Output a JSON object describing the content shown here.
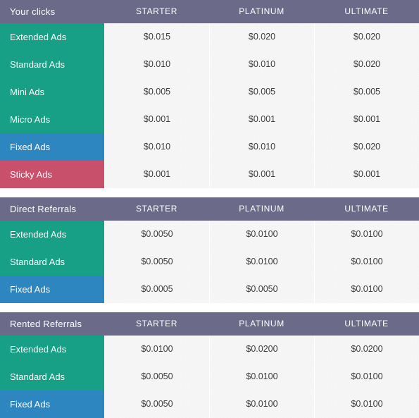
{
  "theme": {
    "header_bg": "#6b6a88",
    "header_text": "#ffffff",
    "green": "#17a085",
    "blue": "#2e86c1",
    "pink": "#c9506b",
    "cell_bg": "#ececec",
    "cell_text": "#3b3b3b",
    "page_bg": "#ffffff"
  },
  "tables": [
    {
      "title": "Your clicks",
      "columns": [
        "STARTER",
        "PLATINUM",
        "ULTIMATE"
      ],
      "rows": [
        {
          "label": "Extended Ads",
          "color": "green",
          "values": [
            "$0.015",
            "$0.020",
            "$0.020"
          ]
        },
        {
          "label": "Standard Ads",
          "color": "green",
          "values": [
            "$0.010",
            "$0.010",
            "$0.020"
          ]
        },
        {
          "label": "Mini Ads",
          "color": "green",
          "values": [
            "$0.005",
            "$0.005",
            "$0.005"
          ]
        },
        {
          "label": "Micro Ads",
          "color": "green",
          "values": [
            "$0.001",
            "$0.001",
            "$0.001"
          ]
        },
        {
          "label": "Fixed Ads",
          "color": "blue",
          "values": [
            "$0.010",
            "$0.010",
            "$0.020"
          ]
        },
        {
          "label": "Sticky Ads",
          "color": "pink",
          "values": [
            "$0.001",
            "$0.001",
            "$0.001"
          ]
        }
      ]
    },
    {
      "title": "Direct Referrals",
      "columns": [
        "STARTER",
        "PLATINUM",
        "ULTIMATE"
      ],
      "rows": [
        {
          "label": "Extended Ads",
          "color": "green",
          "values": [
            "$0.0050",
            "$0.0100",
            "$0.0100"
          ]
        },
        {
          "label": "Standard Ads",
          "color": "green",
          "values": [
            "$0.0050",
            "$0.0100",
            "$0.0100"
          ]
        },
        {
          "label": "Fixed Ads",
          "color": "blue",
          "values": [
            "$0.0005",
            "$0.0050",
            "$0.0100"
          ]
        }
      ]
    },
    {
      "title": "Rented Referrals",
      "columns": [
        "STARTER",
        "PLATINUM",
        "ULTIMATE"
      ],
      "rows": [
        {
          "label": "Extended Ads",
          "color": "green",
          "values": [
            "$0.0100",
            "$0.0200",
            "$0.0200"
          ]
        },
        {
          "label": "Standard Ads",
          "color": "green",
          "values": [
            "$0.0050",
            "$0.0100",
            "$0.0100"
          ]
        },
        {
          "label": "Fixed Ads",
          "color": "blue",
          "values": [
            "$0.0050",
            "$0.0100",
            "$0.0100"
          ]
        }
      ]
    }
  ]
}
